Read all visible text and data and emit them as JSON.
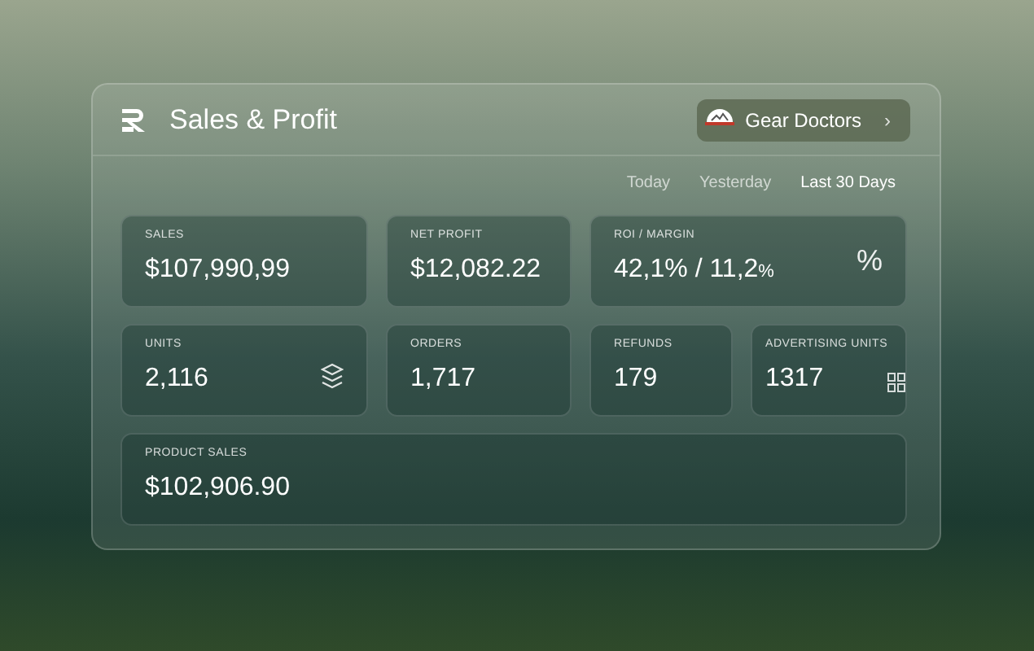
{
  "header": {
    "title": "Sales & Profit",
    "account": {
      "name": "Gear Doctors",
      "chevron": "›"
    }
  },
  "ranges": [
    {
      "label": "Today",
      "selected": false
    },
    {
      "label": "Yesterday",
      "selected": false
    },
    {
      "label": "Last 30 Days",
      "selected": true
    }
  ],
  "rows": [
    [
      {
        "label": "SALES",
        "value": "$107,990,99",
        "kind": "plain"
      },
      {
        "label": "NET PROFIT",
        "value": "$12,082.22",
        "kind": "plain"
      },
      {
        "label": "ROI / MARGIN",
        "value": "42,1% / 11,2",
        "suffix": "%",
        "kind": "glyph",
        "glyph": "%"
      }
    ],
    [
      {
        "label": "UNITS",
        "value": "2,116",
        "kind": "layers"
      },
      {
        "label": "ORDERS",
        "value": "1,717",
        "kind": "plain"
      },
      {
        "label": "REFUNDS",
        "value": "179",
        "kind": "plain"
      },
      {
        "label": "ADVERTISING UNITS",
        "value": "1317",
        "kind": "grid"
      }
    ],
    [
      {
        "label": "PRODUCT SALES",
        "value": "$102,906.90",
        "kind": "plain"
      }
    ]
  ]
}
